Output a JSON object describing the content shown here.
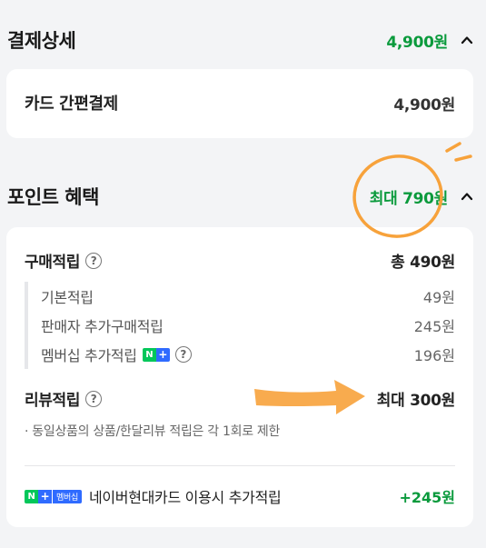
{
  "payment": {
    "title": "결제상세",
    "total": "4,900원",
    "method_label": "카드 간편결제",
    "method_amount": "4,900원"
  },
  "points": {
    "title": "포인트 혜택",
    "max_total": "최대 790원",
    "purchase": {
      "label": "구매적립",
      "total": "총 490원",
      "items": [
        {
          "label": "기본적립",
          "value": "49원"
        },
        {
          "label": "판매자 추가구매적립",
          "value": "245원"
        },
        {
          "label": "멤버십 추가적립",
          "value": "196원"
        }
      ]
    },
    "review": {
      "label": "리뷰적립",
      "value": "최대 300원",
      "note": "· 동일상품의 상품/한달리뷰 적립은 각 1회로 제한"
    },
    "card_benefit": {
      "badge_text": "멤버십",
      "label": "네이버현대카드 이용시 추가적립",
      "value": "+245원"
    }
  },
  "badge": {
    "n": "N",
    "plus": "+"
  },
  "help_glyph": "?",
  "colors": {
    "green": "#0a9a3c",
    "annotation": "#f7a23b",
    "naver_green": "#03c75a",
    "pay_blue": "#2f6bff"
  }
}
